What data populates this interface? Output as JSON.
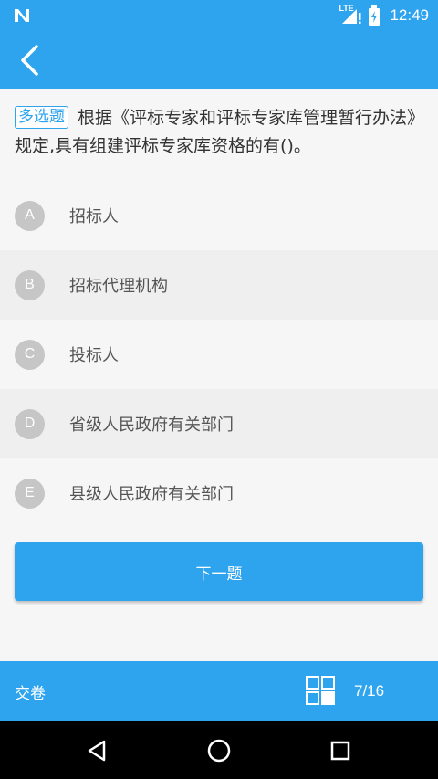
{
  "status_bar": {
    "network": "LTE",
    "time": "12:49"
  },
  "app_bar": {
    "back_icon": "chevron-left-icon"
  },
  "question": {
    "tag": "多选题",
    "text": "根据《评标专家和评标专家库管理暂行办法》规定,具有组建评标专家库资格的有()。"
  },
  "options": [
    {
      "letter": "A",
      "text": "招标人"
    },
    {
      "letter": "B",
      "text": "招标代理机构"
    },
    {
      "letter": "C",
      "text": "投标人"
    },
    {
      "letter": "D",
      "text": "省级人民政府有关部门"
    },
    {
      "letter": "E",
      "text": "县级人民政府有关部门"
    }
  ],
  "next_button": "下一题",
  "bottom_bar": {
    "submit_label": "交卷",
    "progress": "7/16",
    "grid_icon": "answer-card-grid-icon"
  },
  "colors": {
    "primary": "#2ea4ef",
    "option_circle": "#c6c6c6",
    "background": "#f6f6f6"
  }
}
